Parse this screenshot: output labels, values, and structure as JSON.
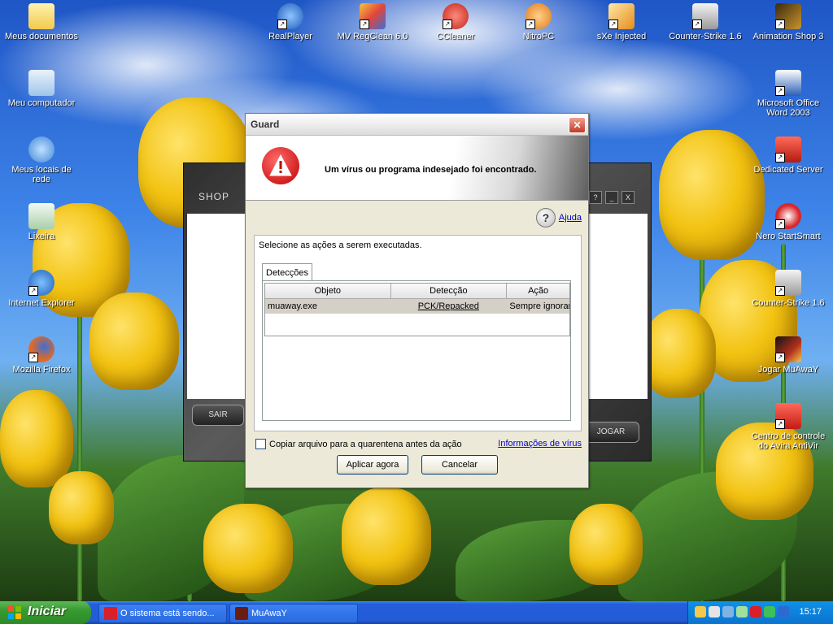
{
  "desktop": {
    "left_icons": [
      {
        "label": "Meus documentos",
        "icon": "folder-documents-icon",
        "color": "#f6d36b"
      },
      {
        "label": "Meu computador",
        "icon": "computer-icon",
        "color": "#9fc5e8"
      },
      {
        "label": "Meus locais de rede",
        "icon": "network-places-icon",
        "color": "#7fb3e6"
      },
      {
        "label": "Lixeira",
        "icon": "recycle-bin-icon",
        "color": "#cfe8cf"
      },
      {
        "label": "Internet Explorer",
        "icon": "internet-explorer-icon",
        "color": "#2c7cd6"
      },
      {
        "label": "Mozilla Firefox",
        "icon": "firefox-icon",
        "color": "#e56a1f"
      }
    ],
    "top_icons": [
      {
        "label": "RealPlayer",
        "icon": "realplayer-icon",
        "color": "#2a6fd0"
      },
      {
        "label": "MV RegClean 6.0",
        "icon": "regclean-icon",
        "color": "#f5c542"
      },
      {
        "label": "CCleaner",
        "icon": "ccleaner-icon",
        "color": "#d9352b"
      },
      {
        "label": "NitroPC",
        "icon": "nitropc-icon",
        "color": "#e8902a"
      },
      {
        "label": "sXe Injected",
        "icon": "sxe-injected-icon",
        "color": "#e58c1a"
      },
      {
        "label": "Counter-Strike 1.6",
        "icon": "counter-strike-icon",
        "color": "#d9d9d9"
      },
      {
        "label": "Animation Shop 3",
        "icon": "animation-shop-icon",
        "color": "#c9952c"
      }
    ],
    "right_icons": [
      {
        "label": "Microsoft Office Word 2003",
        "icon": "word-icon",
        "color": "#2b5fb8"
      },
      {
        "label": "Dedicated Server",
        "icon": "dedicated-server-icon",
        "color": "#d42a1e"
      },
      {
        "label": "Nero StartSmart",
        "icon": "nero-icon",
        "color": "#d8262b"
      },
      {
        "label": "Counter-Strike 1.6",
        "icon": "counter-strike-icon",
        "color": "#d9d9d9"
      },
      {
        "label": "Jogar MuAwaY",
        "icon": "muaway-icon",
        "color": "#b0301e"
      },
      {
        "label": "Centro de controle do Avira AntiVir",
        "icon": "avira-icon",
        "color": "#d8202a"
      }
    ]
  },
  "launcher": {
    "shop_label": "SHOP",
    "sair_label": "SAIR",
    "jogar_label": "JOGAR",
    "controls": [
      "?",
      "_",
      "X"
    ]
  },
  "guard": {
    "title": "Guard",
    "headline": "Um vírus ou programa indesejado foi encontrado.",
    "help_label": "Ajuda",
    "instruction": "Selecione as ações a serem executadas.",
    "tab_label": "Detecções",
    "columns": [
      "Objeto",
      "Detecção",
      "Ação"
    ],
    "rows": [
      {
        "objeto": "muaway.exe",
        "deteccao": "PCK/Repacked",
        "acao": "Sempre ignorar"
      }
    ],
    "quarantine_checkbox_label": "Copiar arquivo para a quarentena antes da ação",
    "quarantine_checked": false,
    "virus_info_link": "Informações de vírus",
    "apply_button": "Aplicar agora",
    "cancel_button": "Cancelar"
  },
  "taskbar": {
    "start_label": "Iniciar",
    "tasks": [
      {
        "label": "O sistema está sendo...",
        "icon": "avira-icon",
        "color": "#d8202a"
      },
      {
        "label": "MuAwaY",
        "icon": "muaway-icon",
        "color": "#b0301e"
      }
    ],
    "tray_icons": [
      "security-shield-icon",
      "tools-icon",
      "network-icon",
      "volume-icon",
      "avira-tray-icon",
      "messenger-icon",
      "display-icon"
    ],
    "clock": "15:17"
  }
}
